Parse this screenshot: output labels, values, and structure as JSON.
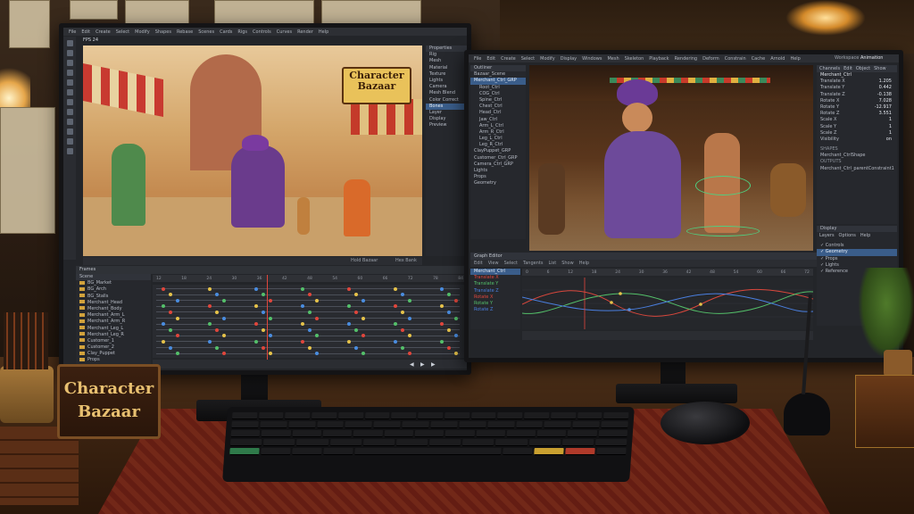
{
  "scene": {
    "desk_plaque": {
      "line1": "Character",
      "line2": "Bazaar"
    }
  },
  "left_app": {
    "menu": [
      "File",
      "Edit",
      "Create",
      "Select",
      "Modify",
      "Shapes",
      "Rebase",
      "Scenes",
      "Cards",
      "Rigs",
      "Controls",
      "Curves",
      "Render",
      "Help"
    ],
    "fps_label": "FPS 24",
    "scene_sign": {
      "line1": "Character",
      "line2": "Bazaar"
    },
    "timeline_header": "Frames",
    "ruler_ticks": [
      "12",
      "18",
      "24",
      "30",
      "36",
      "42",
      "48",
      "54",
      "60",
      "66",
      "72",
      "78",
      "84"
    ],
    "layers_header": "Scene",
    "layers": [
      "BG_Market",
      "BG_Arch",
      "BG_Stalls",
      "Merchant_Head",
      "Merchant_Body",
      "Merchant_Arm_L",
      "Merchant_Arm_R",
      "Merchant_Leg_L",
      "Merchant_Leg_R",
      "Customer_1",
      "Customer_2",
      "Clay_Puppet",
      "Props"
    ],
    "side_panel_header": "Properties",
    "side_items": [
      "Rig",
      "Mesh",
      "Material",
      "Texture",
      "Lights",
      "Camera",
      "Mesh Blend",
      "Color Correct",
      "Bones",
      "Layer",
      "Display",
      "Preview"
    ],
    "status_left": "Hold Bazaar",
    "status_right": "Hex Bank"
  },
  "right_app": {
    "menu": [
      "File",
      "Edit",
      "Create",
      "Select",
      "Modify",
      "Display",
      "Windows",
      "Mesh",
      "Skeleton",
      "Playback",
      "Rendering",
      "Deform",
      "Constrain",
      "Cache",
      "Arnold",
      "Help"
    ],
    "workspace_label": "Workspace",
    "workspace_value": "Animation",
    "outliner_header": "Outliner",
    "outliner_items": [
      "Bazaar_Scene",
      "Merchant_Ctrl_GRP",
      "Root_Ctrl",
      "COG_Ctrl",
      "Spine_Ctrl",
      "Chest_Ctrl",
      "Head_Ctrl",
      "Jaw_Ctrl",
      "Arm_L_Ctrl",
      "Arm_R_Ctrl",
      "Leg_L_Ctrl",
      "Leg_R_Ctrl",
      "ClayPuppet_GRP",
      "Customer_Ctrl_GRP",
      "Camera_Ctrl_GRP",
      "Lights",
      "Props",
      "Geometry"
    ],
    "channel_tabs": [
      "Channels",
      "Edit",
      "Object",
      "Show"
    ],
    "channel_object": "Merchant_Ctrl",
    "channels": [
      {
        "name": "Translate X",
        "value": "1.205"
      },
      {
        "name": "Translate Y",
        "value": "0.442"
      },
      {
        "name": "Translate Z",
        "value": "-0.138"
      },
      {
        "name": "Rotate X",
        "value": "7.028"
      },
      {
        "name": "Rotate Y",
        "value": "-12.917"
      },
      {
        "name": "Rotate Z",
        "value": "3.551"
      },
      {
        "name": "Scale X",
        "value": "1"
      },
      {
        "name": "Scale Y",
        "value": "1"
      },
      {
        "name": "Scale Z",
        "value": "1"
      },
      {
        "name": "Visibility",
        "value": "on"
      }
    ],
    "shapes_header": "SHAPES",
    "shapes_value": "Merchant_CtrlShape",
    "outputs_header": "OUTPUTS",
    "outputs_value": "Merchant_Ctrl_parentConstraint1",
    "display_header": "Display",
    "display_tabs": [
      "Layers",
      "Options",
      "Help"
    ],
    "display_layers": [
      "Controls",
      "Geometry",
      "Props",
      "Lights",
      "Reference"
    ],
    "graph_header": "Graph Editor",
    "graph_menu": [
      "Edit",
      "View",
      "Select",
      "Tangents",
      "List",
      "Show",
      "Help"
    ],
    "graph_channels": [
      "Merchant_Ctrl",
      "Translate X",
      "Translate Y",
      "Translate Z",
      "Rotate X",
      "Rotate Y",
      "Rotate Z"
    ],
    "graph_ticks": [
      "0",
      "6",
      "12",
      "18",
      "24",
      "30",
      "36",
      "42",
      "48",
      "54",
      "60",
      "66",
      "72"
    ]
  },
  "colors": {
    "ui_bg": "#232529",
    "selection": "#3a5d8a",
    "keyframe_red": "#e0463c",
    "keyframe_yellow": "#e6c34a",
    "keyframe_blue": "#4a8de0",
    "curve_red": "#d9473c",
    "curve_green": "#54c06a",
    "curve_blue": "#4a7fe0"
  }
}
